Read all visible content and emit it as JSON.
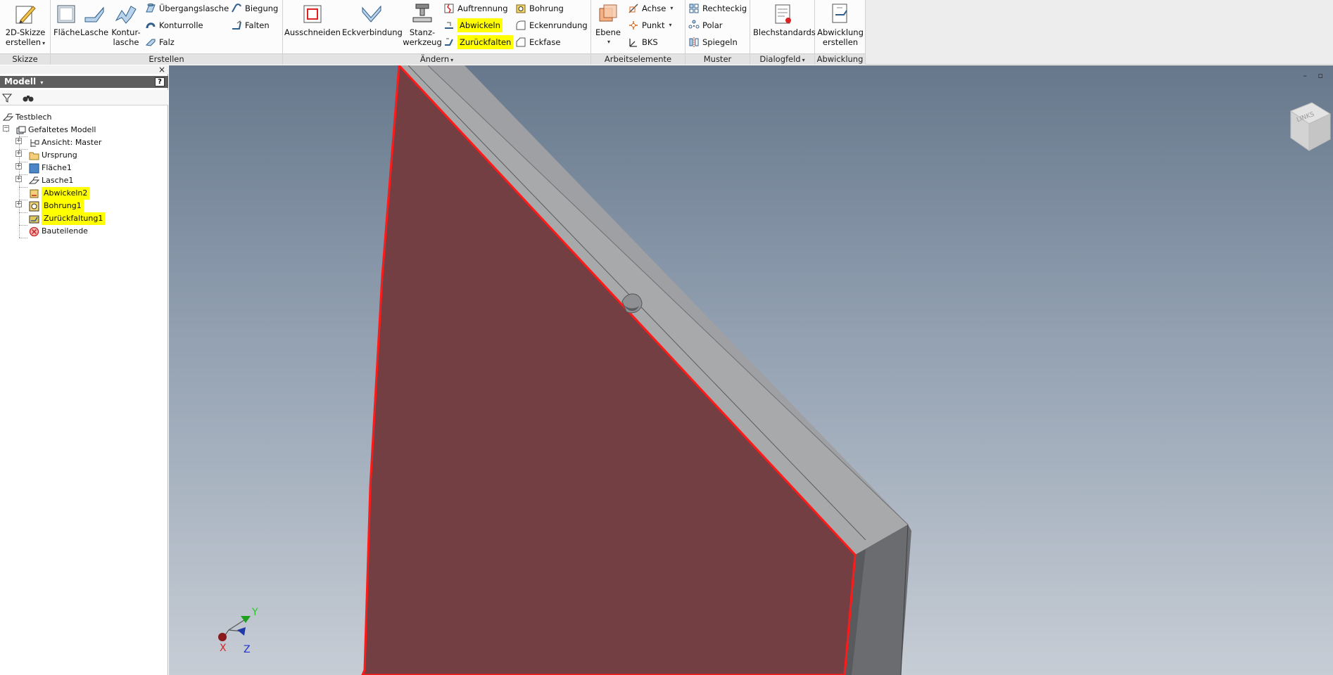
{
  "ribbon": {
    "panels": {
      "skizze": "Skizze",
      "erstellen": "Erstellen",
      "aendern": "Ändern",
      "arbeitselemente": "Arbeitselemente",
      "muster": "Muster",
      "dialogfeld": "Dialogfeld",
      "abwicklung": "Abwicklung"
    },
    "skizze": {
      "sketch_line1": "2D-Skizze",
      "sketch_line2": "erstellen"
    },
    "erstellen": {
      "flaeche": "Fläche",
      "lasche": "Lasche",
      "kontur_line1": "Kontur-",
      "kontur_line2": "lasche",
      "uebergangslasche": "Übergangslasche",
      "konturrolle": "Konturrolle",
      "falz": "Falz",
      "biegung": "Biegung",
      "falten": "Falten"
    },
    "aendern": {
      "ausschneiden": "Ausschneiden",
      "eckverbindung": "Eckverbindung",
      "stanz_line1": "Stanz-",
      "stanz_line2": "werkzeug",
      "auftrennung": "Auftrennung",
      "abwickeln": "Abwickeln",
      "zurueckfalten": "Zurückfalten",
      "bohrung": "Bohrung",
      "eckenrundung": "Eckenrundung",
      "eckfase": "Eckfase"
    },
    "arbeitselemente": {
      "ebene": "Ebene",
      "achse": "Achse",
      "punkt": "Punkt",
      "bks": "BKS"
    },
    "muster": {
      "rechteckig": "Rechteckig",
      "polar": "Polar",
      "spiegeln": "Spiegeln"
    },
    "dialogfeld": {
      "blechstandards": "Blechstandards"
    },
    "abwicklung": {
      "line1": "Abwicklung",
      "line2": "erstellen"
    }
  },
  "browser": {
    "close": "×",
    "title": "Modell",
    "help": "?",
    "tree": [
      {
        "label": "Testblech"
      },
      {
        "label": "Gefaltetes Modell"
      },
      {
        "label": "Ansicht: Master"
      },
      {
        "label": "Ursprung"
      },
      {
        "label": "Fläche1"
      },
      {
        "label": "Lasche1"
      },
      {
        "label": "Abwickeln2",
        "highlighted": true
      },
      {
        "label": "Bohrung1",
        "highlighted": true
      },
      {
        "label": "Zurückfaltung1",
        "highlighted": true
      },
      {
        "label": "Bauteilende"
      }
    ]
  },
  "viewport": {
    "viewcube_label": "LINKS",
    "triad": {
      "x": "X",
      "y": "Y",
      "z": "Z"
    },
    "colors": {
      "face": "#733f42",
      "edge_highlight": "#ff1a1a",
      "top_face": "#a8a9ab",
      "side_face": "#6a6c70"
    }
  }
}
